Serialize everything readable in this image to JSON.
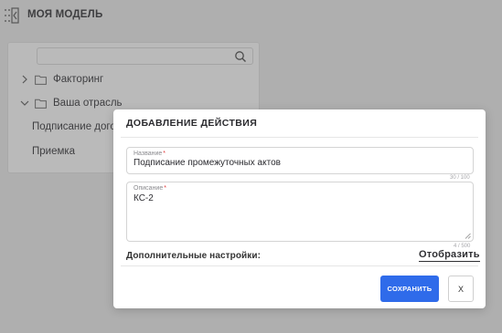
{
  "app": {
    "title": "МОЯ МОДЕЛЬ",
    "logo_icon": "sidebar-toggle-icon"
  },
  "tree": {
    "search_placeholder": "",
    "items": [
      {
        "label": "Факторинг",
        "expanded": false
      },
      {
        "label": "Ваша отрасль",
        "expanded": true
      }
    ],
    "children": [
      {
        "label": "Подписание договора"
      },
      {
        "label": "Приемка"
      }
    ]
  },
  "modal": {
    "title": "ДОБАВЛЕНИЕ ДЕЙСТВИЯ",
    "name_field": {
      "label": "Название",
      "value": "Подписание промежуточных актов",
      "counter": "30 / 100"
    },
    "description_field": {
      "label": "Описание",
      "value": "КС-2",
      "counter": "4 / 500"
    },
    "extra_settings_label": "Дополнительные настройки:",
    "show_link": "Отобразить",
    "save_button": "СОХРАНИТЬ",
    "close_button": "X"
  },
  "colors": {
    "accent": "#2f6bea",
    "required": "#e23b3b",
    "overlay": "rgba(90,90,90,0.42)"
  }
}
